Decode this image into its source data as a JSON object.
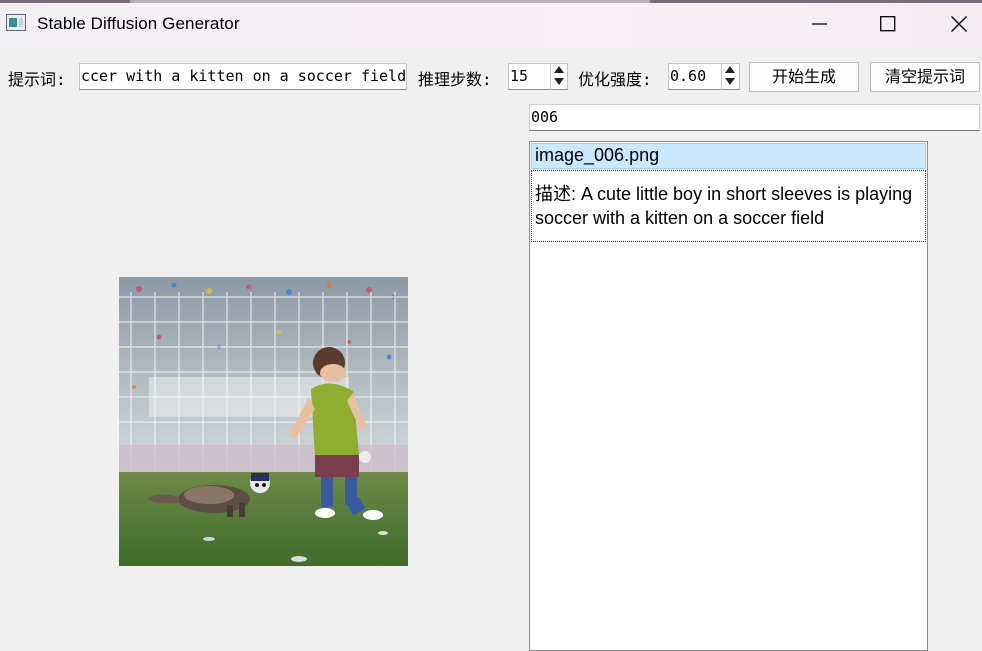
{
  "window": {
    "title": "Stable Diffusion Generator"
  },
  "toolbar": {
    "prompt_label": "提示词:",
    "prompt_value": "ccer with a kitten on a soccer field",
    "steps_label": "推理步数:",
    "steps_value": "15",
    "strength_label": "优化强度:",
    "strength_value": "0.60",
    "generate_label": "开始生成",
    "clear_label": "清空提示词"
  },
  "search": {
    "value": "006"
  },
  "list": {
    "items": [
      {
        "filename": "image_006.png",
        "description": "描述: A cute little boy in short sleeves is playing soccer with a kitten on a soccer field"
      }
    ]
  },
  "preview": {
    "subject": "boy playing soccer with a kitten on a soccer field"
  },
  "colors": {
    "selection": "#cce8ff",
    "selection_border": "#99d1ff",
    "window_bg": "#f0f0f0"
  }
}
